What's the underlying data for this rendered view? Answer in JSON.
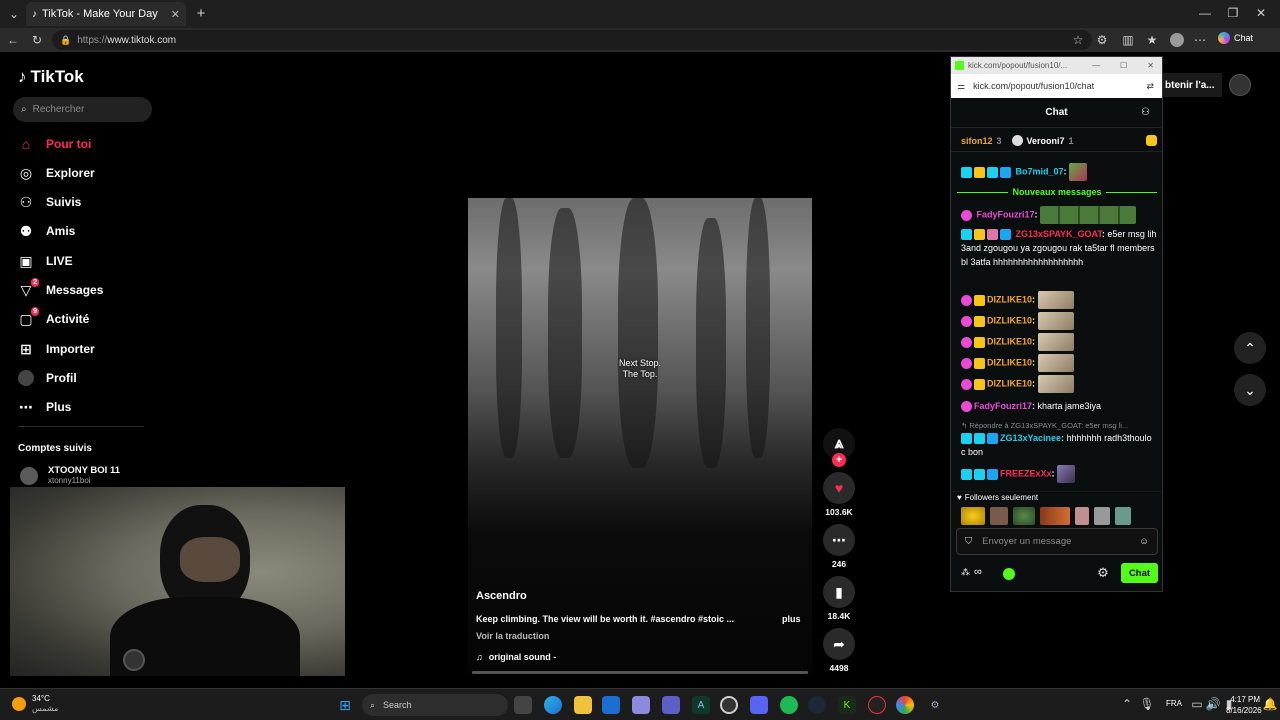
{
  "browser": {
    "tab_title": "TikTok - Make Your Day",
    "url_prefix": "https://",
    "url_domain": "www.tiktok.com",
    "profile_chat": "Chat"
  },
  "tiktok": {
    "logo": "TikTok",
    "search_placeholder": "Rechercher",
    "nav": [
      {
        "label": "Pour toi",
        "icon": "home-icon",
        "active": true
      },
      {
        "label": "Explorer",
        "icon": "compass-icon"
      },
      {
        "label": "Suivis",
        "icon": "following-icon"
      },
      {
        "label": "Amis",
        "icon": "friends-icon"
      },
      {
        "label": "LIVE",
        "icon": "live-icon"
      },
      {
        "label": "Messages",
        "icon": "messages-icon",
        "badge": "2"
      },
      {
        "label": "Activité",
        "icon": "activity-icon",
        "badge": "9"
      },
      {
        "label": "Importer",
        "icon": "upload-icon"
      },
      {
        "label": "Profil",
        "icon": "avatar"
      },
      {
        "label": "Plus",
        "icon": "more-icon"
      }
    ],
    "followed_heading": "Comptes suivis",
    "followed": [
      {
        "name": "XTOONY BOI 11",
        "handle": "xtonny11boi"
      }
    ],
    "get_app": "btenir l'a...",
    "video": {
      "overlay_text_1": "Next Stop.",
      "overlay_text_2": "The Top.",
      "author": "Ascendro",
      "caption": "Keep climbing. The view will be worth it. #ascendro #stoic ...",
      "more": "plus",
      "translate": "Voir la traduction",
      "sound": "original sound - "
    },
    "actions": {
      "likes": "103.6K",
      "comments": "246",
      "saves": "18.4K",
      "shares": "4498"
    }
  },
  "kick": {
    "titlebar": "kick.com/popout/fusion10/...",
    "url": "kick.com/popout/fusion10/chat",
    "header": "Chat",
    "pinned": [
      {
        "name": "sifon12",
        "count": "3"
      },
      {
        "name": "Verooni7",
        "count": "1"
      }
    ],
    "new_messages": "Nouveaux messages",
    "messages": [
      {
        "user": "Bo7mid_07",
        "color": "#1ad1f2",
        "text": "",
        "emote": true
      },
      {
        "user": "FadyFouzri17",
        "color": "#e94bd6",
        "text": "",
        "emotes": 5
      },
      {
        "user": "ZG13xSPAYK_GOAT",
        "color": "#ff2a55",
        "text": "e5er msg lih 3and zgougou ya zgougou rak ta5tar fl members bl 3atfa hhhhhhhhhhhhhhhhhh"
      },
      {
        "user": "DIZLIKE10",
        "color": "#f5a623",
        "text": "",
        "emote": true
      },
      {
        "user": "DIZLIKE10",
        "color": "#f5a623",
        "text": "",
        "emote": true
      },
      {
        "user": "DIZLIKE10",
        "color": "#f5a623",
        "text": "",
        "emote": true
      },
      {
        "user": "DIZLIKE10",
        "color": "#f5a623",
        "text": "",
        "emote": true
      },
      {
        "user": "DIZLIKE10",
        "color": "#f5a623",
        "text": "",
        "emote": true
      },
      {
        "user": "FadyFouzri17",
        "color": "#e94bd6",
        "text": "kharta jame3iya"
      },
      {
        "reply": "Répondre à ZG13xSPAYK_GOAT: e5er msg li..."
      },
      {
        "user": "ZG13xYacinee",
        "color": "#1ad1f2",
        "text": "hhhhhhh radh3thoulo c bon"
      },
      {
        "user": "FREEZExXx",
        "color": "#ff2a55",
        "text": "",
        "emote": true
      }
    ],
    "followers_only": "Followers seulement",
    "input_placeholder": "Envoyer un message",
    "send": "Chat",
    "infinity": "∞"
  },
  "taskbar": {
    "weather_temp": "34°C",
    "weather_desc": "مشمس",
    "search": "Search",
    "lang": "FRA",
    "time": "4:17 PM",
    "date": "8/16/2026"
  }
}
